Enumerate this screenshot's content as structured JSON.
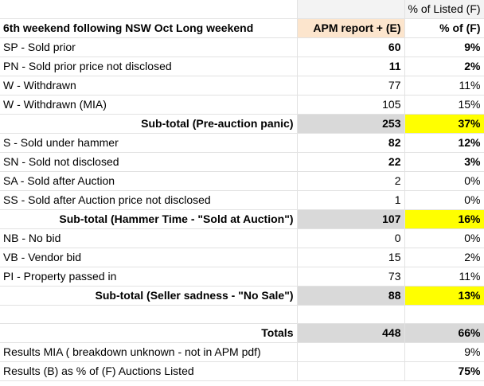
{
  "header": {
    "pct_listed_label": "% of Listed (F)",
    "title": "6th weekend following NSW Oct Long weekend",
    "col_e": "APM report + (E)",
    "col_f": "% of (F)"
  },
  "rows": [
    {
      "label": "SP - Sold prior",
      "value": "60",
      "pct": "9%",
      "bold": true
    },
    {
      "label": "PN - Sold prior price not disclosed",
      "value": "11",
      "pct": "2%",
      "bold": true
    },
    {
      "label": "W - Withdrawn",
      "value": "77",
      "pct": "11%",
      "bold": false
    },
    {
      "label": "W - Withdrawn (MIA)",
      "value": "105",
      "pct": "15%",
      "bold": false
    }
  ],
  "subtotal1": {
    "label": "Sub-total (Pre-auction panic)",
    "value": "253",
    "pct": "37%"
  },
  "rows2": [
    {
      "label": "S - Sold under hammer",
      "value": "82",
      "pct": "12%",
      "bold": true
    },
    {
      "label": "SN - Sold not disclosed",
      "value": "22",
      "pct": "3%",
      "bold": true
    },
    {
      "label": "SA - Sold after Auction",
      "value": "2",
      "pct": "0%",
      "bold": false
    },
    {
      "label": "SS - Sold after Auction price not disclosed",
      "value": "1",
      "pct": "0%",
      "bold": false
    }
  ],
  "subtotal2": {
    "label": "Sub-total (Hammer Time - \"Sold at Auction\")",
    "value": "107",
    "pct": "16%"
  },
  "rows3": [
    {
      "label": "NB - No bid",
      "value": "0",
      "pct": "0%",
      "bold": false
    },
    {
      "label": "VB - Vendor bid",
      "value": "15",
      "pct": "2%",
      "bold": false
    },
    {
      "label": "PI - Property passed in",
      "value": "73",
      "pct": "11%",
      "bold": false
    }
  ],
  "subtotal3": {
    "label": "Sub-total (Seller sadness - \"No Sale\")",
    "value": "88",
    "pct": "13%"
  },
  "totals": {
    "label": "Totals",
    "value": "448",
    "pct": "66%"
  },
  "results_mia": {
    "label": "Results MIA ( breakdown unknown - not in APM pdf)",
    "pct": "9%"
  },
  "results_b": {
    "label": "Results (B) as % of (F) Auctions Listed",
    "pct": "75%"
  }
}
